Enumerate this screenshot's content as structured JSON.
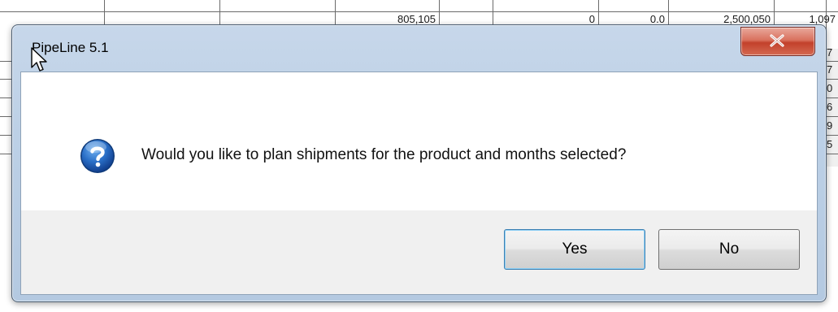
{
  "dialog": {
    "title": "PipeLine 5.1",
    "message": "Would you like to plan shipments for the product and months selected?",
    "buttons": {
      "yes_label": "Yes",
      "no_label": "No"
    },
    "icons": {
      "message_icon": "question-icon",
      "close_icon": "close-icon"
    }
  },
  "background_sheet": {
    "row0": [
      "805,105",
      "0",
      "0.0",
      "2,500,050",
      "1,097"
    ],
    "right_col_digits": [
      "7",
      "7",
      "0",
      "6",
      "9",
      "5"
    ]
  },
  "colors": {
    "frame": "#bcd0e6",
    "close_button": "#c2412b",
    "question_icon": "#1d5fb3",
    "button_area": "#f0f0f0"
  }
}
